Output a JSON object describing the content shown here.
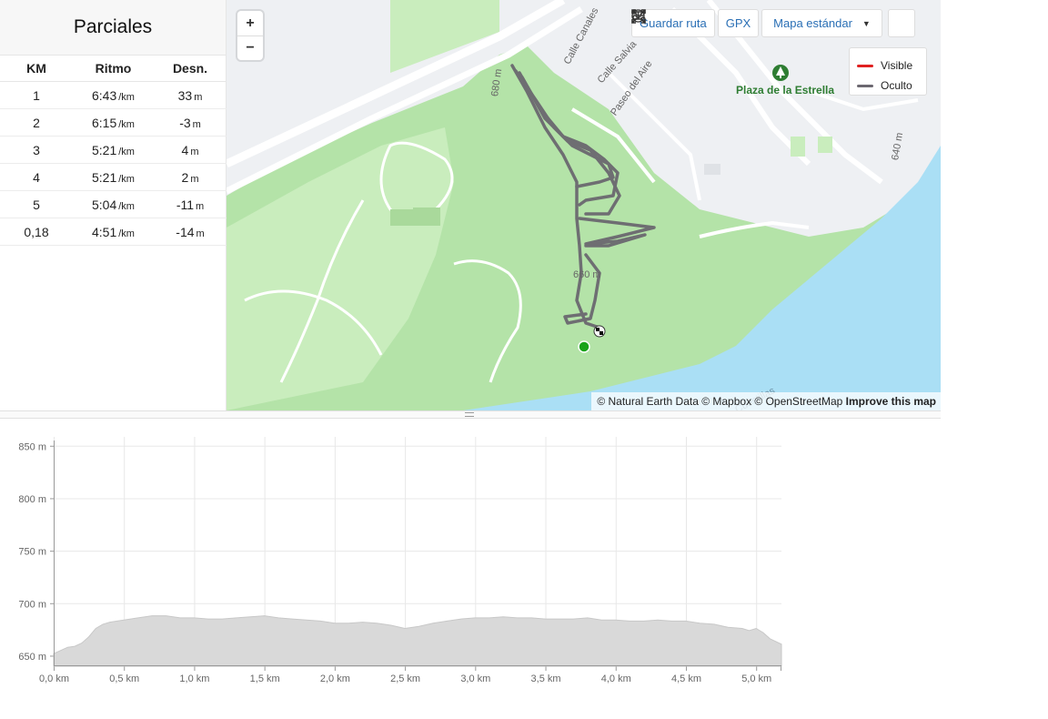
{
  "splits": {
    "title": "Parciales",
    "headers": {
      "km": "KM",
      "pace": "Ritmo",
      "elev": "Desn."
    },
    "rows": [
      {
        "km": "1",
        "pace": "6:43",
        "pace_unit": "/km",
        "elev": "33",
        "elev_unit": "m"
      },
      {
        "km": "2",
        "pace": "6:15",
        "pace_unit": "/km",
        "elev": "-3",
        "elev_unit": "m"
      },
      {
        "km": "3",
        "pace": "5:21",
        "pace_unit": "/km",
        "elev": "4",
        "elev_unit": "m"
      },
      {
        "km": "4",
        "pace": "5:21",
        "pace_unit": "/km",
        "elev": "2",
        "elev_unit": "m"
      },
      {
        "km": "5",
        "pace": "5:04",
        "pace_unit": "/km",
        "elev": "-11",
        "elev_unit": "m"
      },
      {
        "km": "0,18",
        "pace": "4:51",
        "pace_unit": "/km",
        "elev": "-14",
        "elev_unit": "m"
      }
    ]
  },
  "map": {
    "zoom_in": "+",
    "zoom_out": "−",
    "toolbar": {
      "save_route": "Guardar ruta",
      "gpx": "GPX",
      "map_style": "Mapa estándar"
    },
    "legend": [
      {
        "label": "Visible",
        "color": "#e02020"
      },
      {
        "label": "Oculto",
        "color": "#6b6870"
      }
    ],
    "place": "Plaza de la Estrella",
    "streets": [
      "Calle Canales",
      "Calle Salvia",
      "Paseo del Aire",
      "Cuestillas"
    ],
    "contours": [
      "680 m",
      "660 m",
      "640 m"
    ],
    "attribution": {
      "text": "© Natural Earth Data © Mapbox © OpenStreetMap",
      "improve": "Improve this map"
    },
    "colors": {
      "park": "#b4e3a8",
      "park_light": "#c9edbd",
      "water": "#aadff5",
      "urban": "#eef0f3",
      "track": "#6b6870",
      "start": "#1aa31a"
    }
  },
  "chart_data": {
    "type": "area",
    "xlabel": "",
    "ylabel": "",
    "y_ticks": [
      "650 m",
      "700 m",
      "750 m",
      "800 m",
      "850 m"
    ],
    "x_ticks": [
      "0,0 km",
      "0,5 km",
      "1,0 km",
      "1,5 km",
      "2,0 km",
      "2,5 km",
      "3,0 km",
      "3,5 km",
      "4,0 km",
      "4,5 km",
      "5,0 km"
    ],
    "xlim": [
      0,
      5.18
    ],
    "ylim": [
      640,
      855
    ],
    "grid": true,
    "x": [
      0,
      0.05,
      0.1,
      0.15,
      0.2,
      0.25,
      0.3,
      0.35,
      0.4,
      0.5,
      0.6,
      0.7,
      0.8,
      0.9,
      1.0,
      1.1,
      1.2,
      1.3,
      1.4,
      1.5,
      1.6,
      1.7,
      1.8,
      1.9,
      2.0,
      2.1,
      2.2,
      2.3,
      2.4,
      2.5,
      2.6,
      2.7,
      2.8,
      2.9,
      3.0,
      3.1,
      3.2,
      3.3,
      3.4,
      3.5,
      3.6,
      3.7,
      3.8,
      3.9,
      4.0,
      4.1,
      4.2,
      4.3,
      4.4,
      4.5,
      4.6,
      4.7,
      4.8,
      4.9,
      4.95,
      5.0,
      5.05,
      5.1,
      5.18
    ],
    "values": [
      652,
      655,
      658,
      659,
      662,
      668,
      676,
      680,
      682,
      684,
      686,
      688,
      688,
      686,
      686,
      685,
      685,
      686,
      687,
      688,
      686,
      685,
      684,
      683,
      681,
      681,
      682,
      681,
      679,
      676,
      678,
      681,
      683,
      685,
      686,
      686,
      687,
      686,
      686,
      685,
      685,
      685,
      686,
      684,
      684,
      683,
      683,
      684,
      683,
      683,
      681,
      680,
      677,
      676,
      674,
      676,
      672,
      666,
      661
    ]
  }
}
